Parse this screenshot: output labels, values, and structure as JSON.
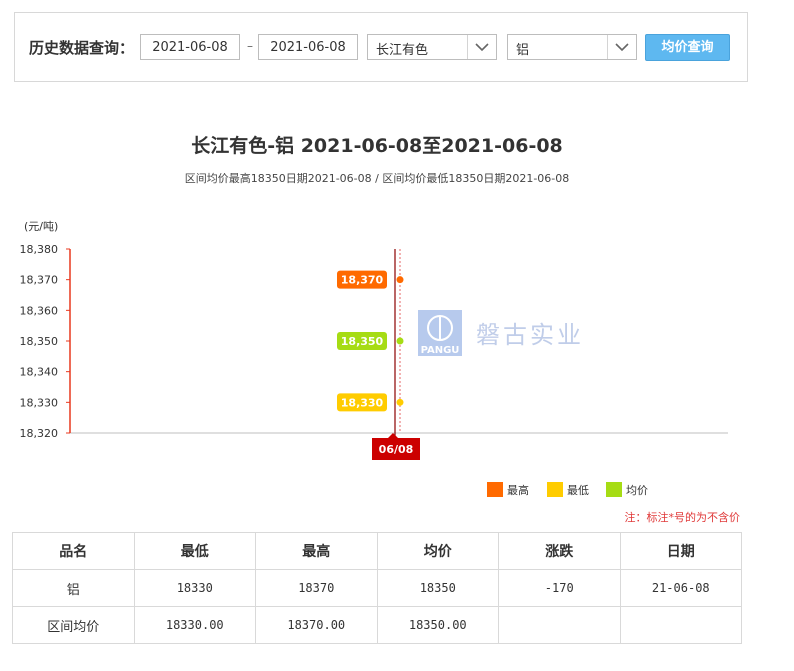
{
  "query": {
    "label": "历史数据查询：",
    "start_date": "2021-06-08",
    "end_date": "2021-06-08",
    "separator": "–",
    "market_select": "长江有色",
    "metal_select": "铝",
    "button_label": "均价查询"
  },
  "chart": {
    "title": "长江有色-铝 2021-06-08至2021-06-08",
    "subtitle": "区间均价最高18350日期2021-06-08 / 区间均价最低18350日期2021-06-08",
    "watermark_text": "磐古实业",
    "watermark_logo_text": "PANGU",
    "note": "注：标注*号的为不含价"
  },
  "chart_data": {
    "type": "line",
    "ylabel": "(元/吨)",
    "ylim": [
      18320,
      18380
    ],
    "yticks": [
      "18,380",
      "18,370",
      "18,360",
      "18,350",
      "18,340",
      "18,330",
      "18,320"
    ],
    "x": [
      "06/08"
    ],
    "series": [
      {
        "name": "最高",
        "values": [
          18370
        ],
        "label": "18,370",
        "color": "#ff6a00"
      },
      {
        "name": "最低",
        "values": [
          18330
        ],
        "label": "18,330",
        "color": "#ffcc00"
      },
      {
        "name": "均价",
        "values": [
          18350
        ],
        "label": "18,350",
        "color": "#a6dc14"
      }
    ],
    "legend": "bottom-right"
  },
  "table": {
    "headers": [
      "品名",
      "最低",
      "最高",
      "均价",
      "涨跌",
      "日期"
    ],
    "rows": [
      [
        "铝",
        "18330",
        "18370",
        "18350",
        "-170",
        "21-06-08"
      ],
      [
        "区间均价",
        "18330.00",
        "18370.00",
        "18350.00",
        "",
        ""
      ]
    ]
  },
  "colors": {
    "axis": "#e8381f",
    "x_label_bg": "#cc0000",
    "button": "#5eb8f0",
    "note": "#e03a3a"
  }
}
